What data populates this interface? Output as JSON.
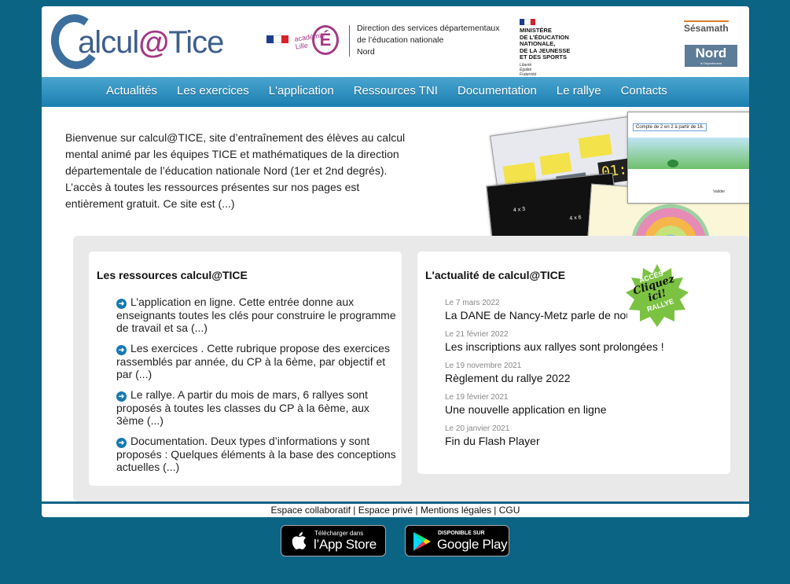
{
  "header": {
    "logo_text_1": "alcul",
    "logo_text_at": "@",
    "logo_text_2": "Tice",
    "academie_label": "académie\nLille",
    "academie_letter": "É",
    "direction_lines": [
      "Direction des services départementaux",
      "de l’éducation nationale",
      "Nord"
    ],
    "ministere_lines": [
      "MINISTÈRE",
      "DE L’ÉDUCATION",
      "NATIONALE,",
      "DE LA JEUNESSE",
      "ET DES SPORTS"
    ],
    "ministere_motto": [
      "Liberté",
      "Égalité",
      "Fraternité"
    ],
    "sesamath_label": "Sésamath",
    "nord_label": "Nord",
    "nord_sub": "le Département"
  },
  "nav": {
    "items": [
      "Actualités",
      "Les exercices",
      "L'application",
      "Ressources TNI",
      "Documentation",
      "Le rallye",
      "Contacts"
    ]
  },
  "intro": {
    "text": "Bienvenue sur calcul@TICE, site d’entraînement des élèves au calcul mental animé par les équipes TICE et mathématiques de la direction départementale de l’éducation nationale Nord (1er et 2nd degrés). L’accès à toutes les ressources présentes sur nos pages est entièrement gratuit. Ce site est (...)"
  },
  "collage": {
    "captions": [
      "Compte de 2 en 2 à partir de 16.",
      "Valider",
      "4 x 3",
      "4 x 6",
      "01:0"
    ]
  },
  "resources": {
    "title": "Les ressources calcul@TICE",
    "items": [
      "L’application en ligne. Cette entrée donne aux enseignants toutes les clés pour construire le programme de travail et sa (...)",
      "Les exercices . Cette rubrique propose des exercices rassemblés par année, du CP à la 6ème, par objectif et par (...)",
      "Le rallye. A partir du mois de mars, 6 rallyes sont proposés à toutes les classes du CP à la 6ème, aux 3ème (...)",
      "Documentation. Deux types d’informations y sont proposés : Quelques éléments à la base des conceptions actuelles (...)"
    ]
  },
  "news": {
    "title": "L'actualité de calcul@TICE",
    "items": [
      {
        "date": "Le 7 mars 2022",
        "title": "La DANE de Nancy-Metz parle de nous"
      },
      {
        "date": "Le 21 février 2022",
        "title": "Les inscriptions aux rallyes sont prolongées !"
      },
      {
        "date": "Le 19 novembre 2021",
        "title": "Règlement du rallye 2022"
      },
      {
        "date": "Le 19 février 2021",
        "title": "Une nouvelle application en ligne"
      },
      {
        "date": "Le 20 janvier 2021",
        "title": "Fin du Flash Player"
      }
    ],
    "badge_top": "ACCÈS",
    "badge_main": "Cliquez ici!",
    "badge_bottom": "RALLYE"
  },
  "footer": {
    "links": [
      "Espace collaboratif",
      "Espace privé",
      "Mentions légales",
      "CGU"
    ]
  },
  "stores": {
    "apple_small": "Télécharger dans",
    "apple_big": "l’App Store",
    "google_small": "DISPONIBLE SUR",
    "google_big": "Google Play"
  },
  "colors": {
    "background": "#0c6485",
    "nav": "#2e90c0",
    "accent": "#a33a86",
    "bullet": "#1679b0"
  }
}
